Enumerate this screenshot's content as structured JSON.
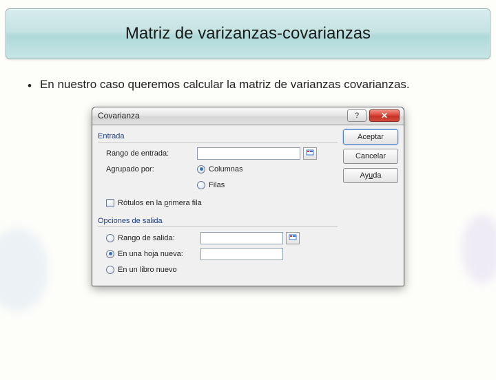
{
  "slide": {
    "title": "Matriz de varizanzas-covarianzas",
    "bullet": "En nuestro caso queremos calcular la matriz de varianzas covarianzas."
  },
  "dialog": {
    "title": "Covarianza",
    "groups": {
      "input": "Entrada",
      "output": "Opciones de salida"
    },
    "labels": {
      "input_range": "Rango de entrada:",
      "grouped_by": "Agrupado por:",
      "columns": "Columnas",
      "rows": "Filas",
      "labels_first_row_pre": "R",
      "labels_first_row_mid": "ótulos en la ",
      "labels_first_row_key": "p",
      "labels_first_row_post": "rimera fila",
      "output_range_pre": "Ran",
      "output_range_key": "g",
      "output_range_post": "o de salida:",
      "new_sheet": "En una hoja nueva:",
      "new_book": "En un libro nuevo"
    },
    "values": {
      "input_range": "",
      "output_range": "",
      "new_sheet": "",
      "grouped_by_selected": "columns",
      "output_selected": "new_sheet",
      "labels_first_row_checked": false
    },
    "buttons": {
      "accept": "Aceptar",
      "cancel": "Cancelar",
      "help_pre": "Ay",
      "help_key": "u",
      "help_post": "da"
    }
  }
}
